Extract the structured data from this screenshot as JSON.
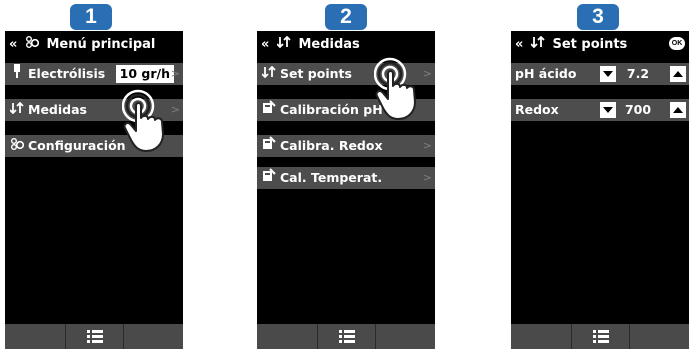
{
  "steps": [
    "1",
    "2",
    "3"
  ],
  "screens": {
    "main_menu": {
      "title": "Menú principal",
      "items": [
        {
          "label": "Electrólisis",
          "value": "10 gr/h"
        },
        {
          "label": "Medidas"
        },
        {
          "label": "Configuración"
        }
      ]
    },
    "medidas": {
      "title": "Medidas",
      "items": [
        {
          "label": "Set points"
        },
        {
          "label": "Calibración pH"
        },
        {
          "label": "Calibra. Redox"
        },
        {
          "label": "Cal. Temperat."
        }
      ]
    },
    "set_points": {
      "title": "Set points",
      "ok_label": "OK",
      "items": [
        {
          "label": "pH ácido",
          "value": "7.2"
        },
        {
          "label": "Redox",
          "value": "700"
        }
      ]
    }
  },
  "glyphs": {
    "back": "«",
    "chevron": ">"
  },
  "colors": {
    "badge": "#2a6fb3",
    "row": "#4d4d4d",
    "screen": "#000000"
  },
  "icons": [
    "back-icon",
    "settings-icon",
    "measure-icon",
    "thermometer-icon",
    "calibration-icon",
    "menu-icon",
    "ok-icon",
    "tap-hand-icon"
  ]
}
